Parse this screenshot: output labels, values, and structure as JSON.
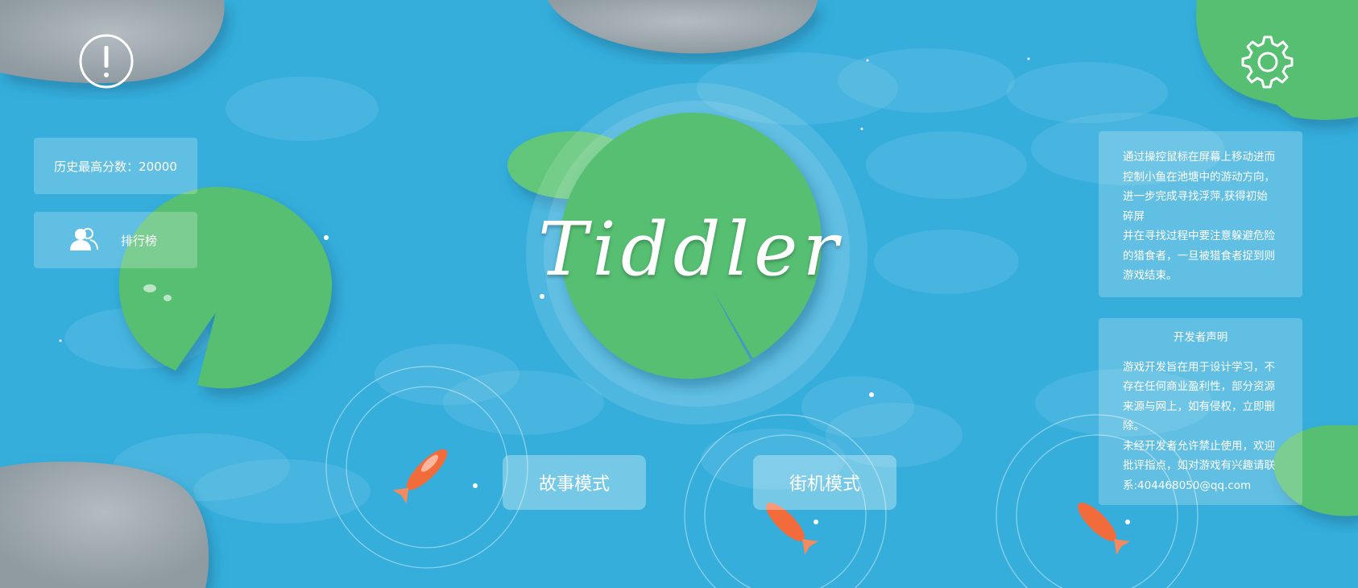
{
  "game": {
    "title": "Tiddler"
  },
  "score": {
    "text": "历史最高分数：20000"
  },
  "leaderboard": {
    "label": "排行榜"
  },
  "help": {
    "text": "通过操控鼠标在屏幕上移动进而\n控制小鱼在池塘中的游动方向，\n进一步完成寻找浮萍,获得初始\n碎屏\n并在寻找过程中要注意躲避危险\n的猎食者，一旦被猎食者捉到则\n游戏结束。"
  },
  "developer": {
    "title": "开发者声明",
    "text": "游戏开发旨在用于设计学习，不\n存在任何商业盈利性，部分资源\n来源与网上，如有侵权，立即删\n除。\n未经开发者允许禁止使用，欢迎\n批评指点，如对游戏有兴趣请联\n系:404468050@qq.com"
  },
  "modes": {
    "story": "故事模式",
    "arcade": "街机模式"
  },
  "icons": {
    "info": "info-icon",
    "settings": "gear-icon",
    "leaderboard": "users-icon"
  },
  "colors": {
    "water": "#35aedc",
    "lily_pad": "#57bf72",
    "stone": "#a3adb3",
    "koi": "#f26b3a"
  }
}
